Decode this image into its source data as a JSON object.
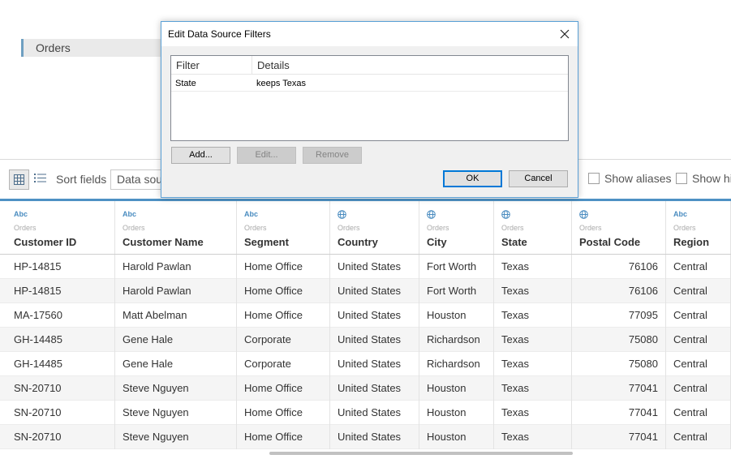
{
  "canvas": {
    "tab_label": "Orders"
  },
  "toolbar": {
    "sort_label": "Sort fields",
    "sort_value": "Data sou",
    "show_aliases_label": "Show aliases",
    "show_hidden_label": "Show hi"
  },
  "dialog": {
    "title": "Edit Data Source Filters",
    "columns": {
      "filter": "Filter",
      "details": "Details"
    },
    "filters": [
      {
        "filter": "State",
        "details": "keeps Texas"
      }
    ],
    "buttons": {
      "add": "Add...",
      "edit": "Edit...",
      "remove": "Remove",
      "ok": "OK",
      "cancel": "Cancel"
    }
  },
  "table": {
    "columns": [
      {
        "type": "Abc",
        "source": "Orders",
        "name": "Customer ID"
      },
      {
        "type": "Abc",
        "source": "Orders",
        "name": "Customer Name"
      },
      {
        "type": "Abc",
        "source": "Orders",
        "name": "Segment"
      },
      {
        "type": "globe",
        "source": "Orders",
        "name": "Country"
      },
      {
        "type": "globe",
        "source": "Orders",
        "name": "City"
      },
      {
        "type": "globe",
        "source": "Orders",
        "name": "State"
      },
      {
        "type": "globe",
        "source": "Orders",
        "name": "Postal Code"
      },
      {
        "type": "Abc",
        "source": "Orders",
        "name": "Region"
      }
    ],
    "rows": [
      [
        "HP-14815",
        "Harold Pawlan",
        "Home Office",
        "United States",
        "Fort Worth",
        "Texas",
        "76106",
        "Central"
      ],
      [
        "HP-14815",
        "Harold Pawlan",
        "Home Office",
        "United States",
        "Fort Worth",
        "Texas",
        "76106",
        "Central"
      ],
      [
        "MA-17560",
        "Matt Abelman",
        "Home Office",
        "United States",
        "Houston",
        "Texas",
        "77095",
        "Central"
      ],
      [
        "GH-14485",
        "Gene Hale",
        "Corporate",
        "United States",
        "Richardson",
        "Texas",
        "75080",
        "Central"
      ],
      [
        "GH-14485",
        "Gene Hale",
        "Corporate",
        "United States",
        "Richardson",
        "Texas",
        "75080",
        "Central"
      ],
      [
        "SN-20710",
        "Steve Nguyen",
        "Home Office",
        "United States",
        "Houston",
        "Texas",
        "77041",
        "Central"
      ],
      [
        "SN-20710",
        "Steve Nguyen",
        "Home Office",
        "United States",
        "Houston",
        "Texas",
        "77041",
        "Central"
      ],
      [
        "SN-20710",
        "Steve Nguyen",
        "Home Office",
        "United States",
        "Houston",
        "Texas",
        "77041",
        "Central"
      ]
    ]
  },
  "colors": {
    "accent": "#4e91c4",
    "dialog_border": "#5aa0d6",
    "ok_border": "#0078d7"
  }
}
